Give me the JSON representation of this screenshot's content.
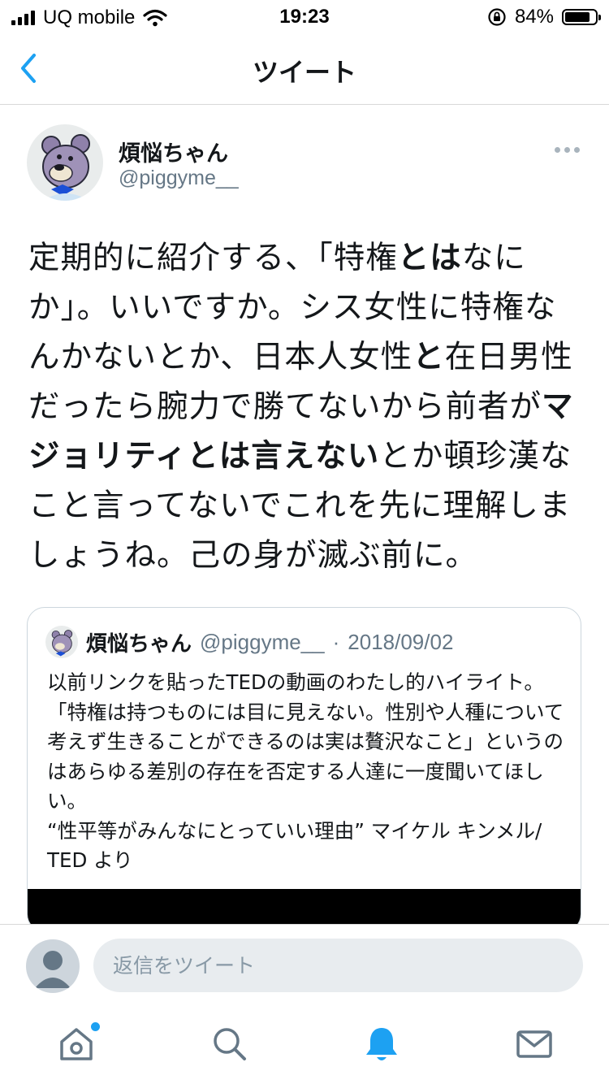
{
  "status_bar": {
    "carrier": "UQ mobile",
    "time": "19:23",
    "battery": "84%",
    "battery_level": 0.84
  },
  "nav": {
    "title": "ツイート"
  },
  "tweet": {
    "author_name": "煩悩ちゃん",
    "author_handle": "@piggyme__",
    "segments": [
      {
        "text": "定期的に紹介する、「特権",
        "bold": false
      },
      {
        "text": "とは",
        "bold": true
      },
      {
        "text": "なにか」。いいですか。シス女性に特権なんかないとか、日本人女性",
        "bold": false
      },
      {
        "text": "と",
        "bold": true
      },
      {
        "text": "在日男性だったら腕力で勝てないから前者が",
        "bold": false
      },
      {
        "text": "マジョリティとは言えない",
        "bold": true
      },
      {
        "text": "とか頓珍漢なこと言ってないでこれを先に理解しましょうね。己の身が滅ぶ前に。",
        "bold": false
      }
    ]
  },
  "quote": {
    "author_name": "煩悩ちゃん",
    "author_handle": "@piggyme__",
    "separator": "·",
    "date": "2018/09/02",
    "text": "以前リンクを貼ったTEDの動画のわたし的ハイライト。「特権は持つものには目に見えない。性別や人種について考えず生きることができるのは実は贅沢なこと」というのはあらゆる差別の存在を否定する人達に一度聞いてほしい。\n“性平等がみんなにとっていい理由” マイケル キンメル/ TED より"
  },
  "reply": {
    "placeholder": "返信をツイート"
  },
  "tabs": [
    {
      "icon": "home-icon",
      "notification_dot": true
    },
    {
      "icon": "search-icon",
      "notification_dot": false
    },
    {
      "icon": "bell-icon",
      "active": true
    },
    {
      "icon": "mail-icon",
      "notification_dot": false
    }
  ],
  "colors": {
    "accent": "#1da1f2",
    "text": "#14171a",
    "muted": "#657786",
    "border": "#ccd6dd"
  }
}
